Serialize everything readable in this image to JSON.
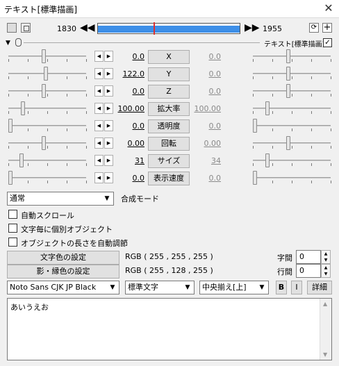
{
  "window": {
    "title": "テキスト[標準描画]",
    "close_glyph": "✕"
  },
  "timeline": {
    "start_frame": "1830",
    "end_frame": "1955",
    "progress_fraction": 0.39
  },
  "header": {
    "label": "テキスト[標準描画]",
    "checked": true
  },
  "params": [
    {
      "name": "X",
      "value": "0.0",
      "end_value": "0.0",
      "left_pos": 0.45,
      "right_pos": 0.45
    },
    {
      "name": "Y",
      "value": "122.0",
      "end_value": "0.0",
      "left_pos": 0.48,
      "right_pos": 0.45
    },
    {
      "name": "Z",
      "value": "0.0",
      "end_value": "0.0",
      "left_pos": 0.45,
      "right_pos": 0.45
    },
    {
      "name": "拡大率",
      "value": "100.00",
      "end_value": "100.00",
      "left_pos": 0.17,
      "right_pos": 0.17
    },
    {
      "name": "透明度",
      "value": "0.0",
      "end_value": "0.0",
      "left_pos": 0.0,
      "right_pos": 0.0
    },
    {
      "name": "回転",
      "value": "0.00",
      "end_value": "0.00",
      "left_pos": 0.45,
      "right_pos": 0.45
    },
    {
      "name": "サイズ",
      "value": "31",
      "end_value": "34",
      "left_pos": 0.15,
      "right_pos": 0.17
    },
    {
      "name": "表示速度",
      "value": "0.0",
      "end_value": "0.0",
      "left_pos": 0.0,
      "right_pos": 0.0
    }
  ],
  "blend": {
    "selected": "通常",
    "label": "合成モード"
  },
  "options": {
    "auto_scroll": "自動スクロール",
    "per_char": "文字毎に個別オブジェクト",
    "auto_length": "オブジェクトの長さを自動調節"
  },
  "colors": {
    "text_color_btn": "文字色の設定",
    "text_color_value": "RGB ( 255 , 255 , 255 )",
    "shadow_color_btn": "影・縁色の設定",
    "shadow_color_value": "RGB ( 255 , 128 , 255 )"
  },
  "spacing": {
    "char_label": "字間",
    "char_value": "0",
    "line_label": "行間",
    "line_value": "0"
  },
  "font": {
    "family": "Noto Sans CJK JP Black",
    "style": "標準文字",
    "align": "中央揃え[上]",
    "bold": "B",
    "italic": "I",
    "detail": "詳細"
  },
  "text": {
    "content": "あいうえお"
  },
  "accent": {
    "timeline_bar": "#3d8fe8",
    "cursor": "#e03030"
  }
}
